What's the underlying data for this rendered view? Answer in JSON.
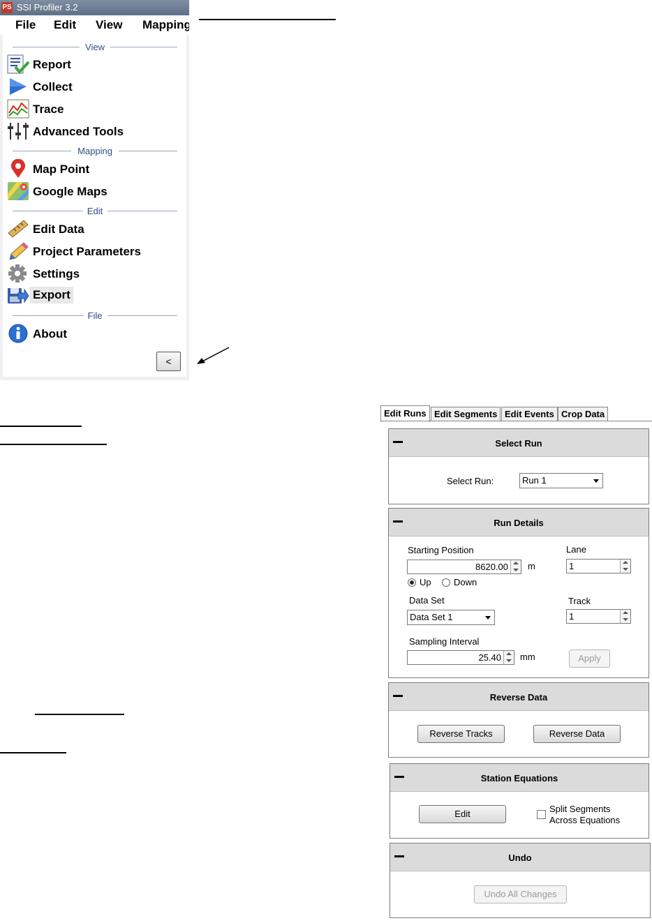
{
  "window": {
    "title": "SSI Profiler 3.2",
    "app_icon": "PS"
  },
  "menu": [
    "File",
    "Edit",
    "View",
    "Mapping"
  ],
  "sidebar": {
    "sections": {
      "view": "View",
      "mapping": "Mapping",
      "edit": "Edit",
      "file": "File"
    },
    "items": {
      "report": "Report",
      "collect": "Collect",
      "trace": "Trace",
      "advanced_tools": "Advanced Tools",
      "map_point": "Map Point",
      "google_maps": "Google Maps",
      "edit_data": "Edit Data",
      "project_parameters": "Project Parameters",
      "settings": "Settings",
      "export": "Export",
      "about": "About"
    },
    "collapse_label": "<"
  },
  "tabs": [
    "Edit Runs",
    "Edit Segments",
    "Edit Events",
    "Crop Data"
  ],
  "select_run": {
    "header": "Select Run",
    "label": "Select Run:",
    "value": "Run 1"
  },
  "run_details": {
    "header": "Run Details",
    "starting_position_label": "Starting Position",
    "starting_position_value": "8620.00",
    "starting_position_unit": "m",
    "direction_up": "Up",
    "direction_down": "Down",
    "data_set_label": "Data Set",
    "data_set_value": "Data Set 1",
    "sampling_interval_label": "Sampling Interval",
    "sampling_interval_value": "25.40",
    "sampling_interval_unit": "mm",
    "lane_label": "Lane",
    "lane_value": "1",
    "track_label": "Track",
    "track_value": "1",
    "apply_label": "Apply"
  },
  "reverse_data": {
    "header": "Reverse Data",
    "reverse_tracks_label": "Reverse Tracks",
    "reverse_data_label": "Reverse Data"
  },
  "station_equations": {
    "header": "Station Equations",
    "edit_label": "Edit",
    "split_line1": "Split Segments",
    "split_line2": "Across Equations"
  },
  "undo": {
    "header": "Undo",
    "undo_all_label": "Undo All Changes"
  }
}
